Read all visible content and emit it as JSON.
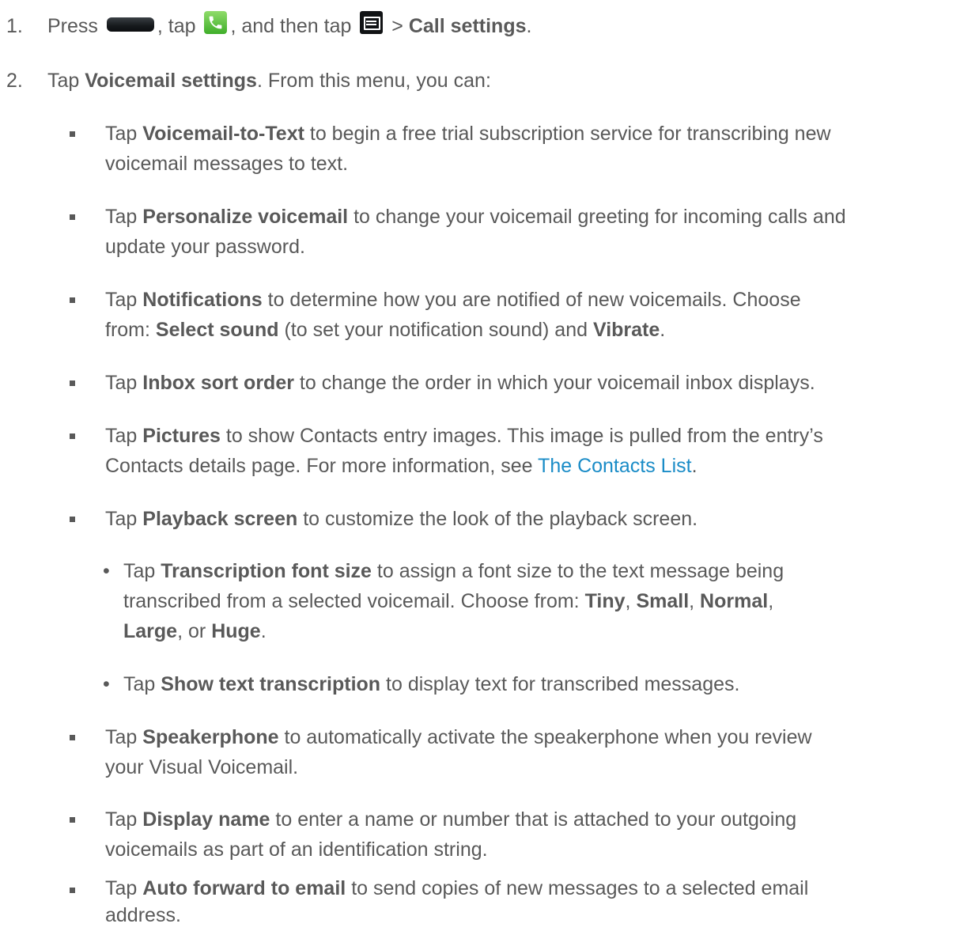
{
  "step1": {
    "num": "1.",
    "press": "Press",
    "comma_tap": ", tap",
    "and_then_tap": ", and then tap",
    "gt": ">",
    "call_settings": "Call settings",
    "period": "."
  },
  "step2": {
    "num": "2.",
    "tap": "Tap",
    "voicemail_settings": "Voicemail settings",
    "rest": ". From this menu, you can:"
  },
  "bullets": {
    "b1": {
      "tap": "Tap",
      "bold": "Voicemail-to-Text",
      "l1": "to begin a free trial subscription service for transcribing new",
      "l2": "voicemail messages to text."
    },
    "b2": {
      "tap": "Tap",
      "bold": "Personalize voicemail",
      "l1": "to change your voicemail greeting for incoming calls and",
      "l2": "update your password."
    },
    "b3": {
      "tap": "Tap",
      "bold": "Notifications",
      "l1": "to determine how you are notified of new voicemails. Choose",
      "from": "from:",
      "select_sound": "Select sound",
      "mid": "(to set your notification sound) and",
      "vibrate": "Vibrate",
      "end": "."
    },
    "b4": {
      "tap": "Tap",
      "bold": "Inbox sort order",
      "l1": "to change the order in which your voicemail inbox displays."
    },
    "b5": {
      "tap": "Tap",
      "bold": "Pictures",
      "l1": "to show Contacts entry images. This image is pulled from the entry’s",
      "l2": "Contacts details page. For more information, see",
      "link": "The Contacts List",
      "end": "."
    },
    "b6": {
      "tap": "Tap",
      "bold": "Playback screen",
      "l1": "to customize the look of the playback screen."
    },
    "b7": {
      "tap": "Tap",
      "bold": "Speakerphone",
      "l1": "to automatically activate the speakerphone when you review",
      "l2": "your Visual Voicemail."
    },
    "b8": {
      "tap": "Tap",
      "bold": "Display name",
      "l1": "to enter a name or number that is attached to your outgoing",
      "l2": "voicemails as part of an identification string."
    },
    "b9": {
      "tap": "Tap",
      "bold": "Auto forward to email",
      "l1": "to send copies of new messages to a selected email",
      "l2": "address."
    }
  },
  "subs": {
    "s1": {
      "mark": "•",
      "tap": "Tap",
      "bold": "Transcription font size",
      "l1": "to assign a font size to the text message being",
      "l2": "transcribed from a selected voicemail. Choose from:",
      "tiny": "Tiny",
      "small": "Small",
      "normal": "Normal",
      "large": "Large",
      "or": "or",
      "huge": "Huge",
      "comma": ",",
      "end": "."
    },
    "s2": {
      "mark": "•",
      "tap": "Tap",
      "bold": "Show text transcription",
      "l1": "to display text for transcribed messages."
    }
  },
  "colors": {
    "text": "#595959",
    "link": "#1a8cc7",
    "phone_green": "#3fae2a"
  },
  "icons": {
    "home_key": "home-key-icon",
    "phone": "phone-app-icon",
    "menu": "menu-key-icon"
  }
}
